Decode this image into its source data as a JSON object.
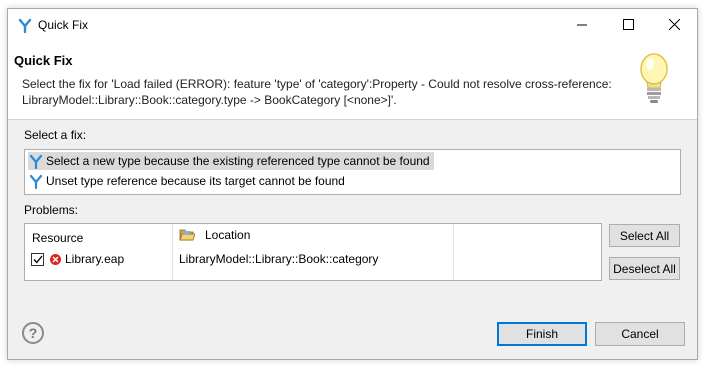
{
  "window": {
    "title": "Quick Fix"
  },
  "header": {
    "title": "Quick Fix",
    "message_line1": "Select the fix for 'Load failed (ERROR): feature 'type' of 'category':Property - Could not resolve cross-reference:",
    "message_line2": "LibraryModel::Library::Book::category.type -> BookCategory [<none>]'."
  },
  "fixes": {
    "label": "Select a fix:",
    "items": [
      {
        "label": "Select a new type because the existing referenced type cannot be found",
        "selected": true,
        "icon": "eclipse-fix-icon"
      },
      {
        "label": "Unset type reference because its target cannot be found",
        "selected": false,
        "icon": "eclipse-fix-icon"
      }
    ]
  },
  "problems": {
    "label": "Problems:",
    "columns": [
      "Resource",
      "Location"
    ],
    "rows": [
      {
        "checked": true,
        "status": "error",
        "resource": "Library.eap",
        "location": "LibraryModel::Library::Book::category"
      }
    ]
  },
  "buttons": {
    "select_all": "Select All",
    "deselect_all": "Deselect All",
    "finish": "Finish",
    "cancel": "Cancel",
    "help": "?"
  },
  "colors": {
    "accent": "#0078d7",
    "error": "#d9261c",
    "selection": "#dadada"
  }
}
